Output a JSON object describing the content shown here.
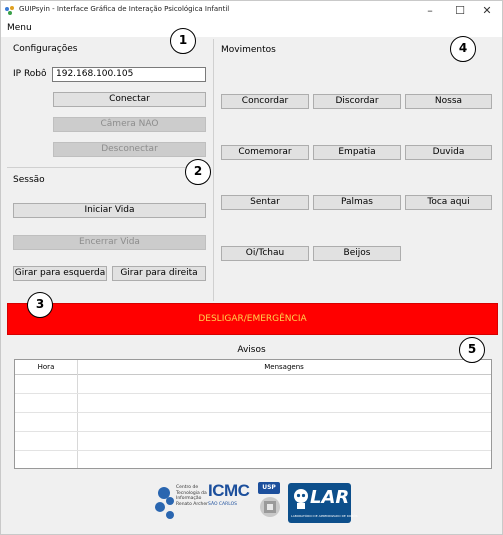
{
  "window": {
    "title": "GUIPsyin - Interface Gráfica de Interação Psicológica Infantil",
    "minimize": "–",
    "maximize": "☐",
    "close": "✕"
  },
  "menubar": {
    "menu": "Menu"
  },
  "config": {
    "title": "Configurações",
    "ip_label": "IP Robô",
    "ip_value": "192.168.100.105",
    "connect": "Conectar",
    "camera": "Câmera NAO",
    "disconnect": "Desconectar"
  },
  "session": {
    "title": "Sessão",
    "start": "Iniciar Vida",
    "stop": "Encerrar Vida",
    "turn_left": "Girar para esquerda",
    "turn_right": "Girar para direita"
  },
  "movements": {
    "title": "Movimentos",
    "buttons": [
      "Concordar",
      "Discordar",
      "Nossa",
      "Comemorar",
      "Empatia",
      "Duvida",
      "Sentar",
      "Palmas",
      "Toca aqui",
      "Oi/Tchau",
      "Beijos"
    ]
  },
  "emergency": {
    "label": "DESLIGAR/EMERGÊNCIA"
  },
  "warnings": {
    "title": "Avisos",
    "columns": [
      "Hora",
      "Mensagens"
    ]
  },
  "callouts": [
    "1",
    "2",
    "3",
    "4",
    "5"
  ],
  "logos": {
    "cti_lines": [
      "Centro de",
      "Tecnologia da",
      "Informação",
      "Renato Archer"
    ],
    "icmc": "ICMC",
    "usp": "USP",
    "icmc_sub": "SÃO CARLOS",
    "lar": "LAR",
    "lar_sub": "LABORATÓRIO DE APRENDIZADO DE ROBÔS"
  },
  "colors": {
    "emergency_bg": "#ff0000",
    "emergency_text": "#ffd34d",
    "window_bg": "#f0f0f0",
    "lar_bg": "#0d4f8b",
    "icmc_blue": "#1c4f9c"
  }
}
